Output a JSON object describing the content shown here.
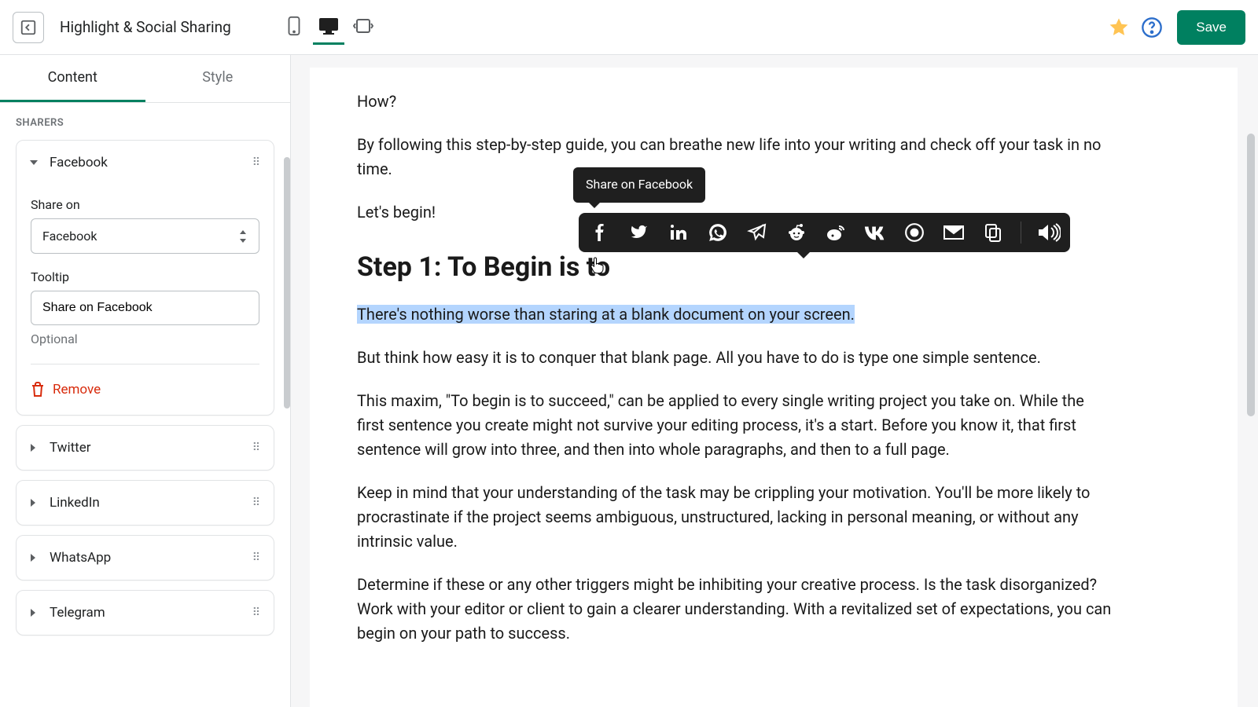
{
  "topbar": {
    "title": "Highlight & Social Sharing",
    "save": "Save"
  },
  "tabs": {
    "content": "Content",
    "style": "Style"
  },
  "sidebar": {
    "section": "SHARERS",
    "items": [
      {
        "name": "Facebook",
        "expanded": true
      },
      {
        "name": "Twitter",
        "expanded": false
      },
      {
        "name": "LinkedIn",
        "expanded": false
      },
      {
        "name": "WhatsApp",
        "expanded": false
      },
      {
        "name": "Telegram",
        "expanded": false
      }
    ],
    "fb": {
      "share_label": "Share on",
      "share_value": "Facebook",
      "tooltip_label": "Tooltip",
      "tooltip_value": "Share on Facebook",
      "optional": "Optional",
      "remove": "Remove"
    }
  },
  "content": {
    "p1": "How?",
    "p2": "By following this step-by-step guide, you can breathe new life into your writing and check off your task in no time.",
    "p3": "Let's begin!",
    "h1": "Step 1: To Begin is to",
    "hl": "There's nothing worse than staring at a blank document on your screen.",
    "p4": "But think how easy it is to conquer that blank page. All you have to do is type one simple sentence.",
    "p5": "This maxim, \"To begin is to succeed,\" can be applied to every single writing project you take on. While the first sentence you create might not survive your editing process, it's a start. Before you know it, that first sentence will grow into three, and then into whole paragraphs, and then to a full page.",
    "p6": "Keep in mind that your understanding of the task may be crippling your motivation. You'll be more likely to procrastinate if the project seems ambiguous, unstructured, lacking in personal meaning, or without any intrinsic value.",
    "p7": "Determine if these or any other triggers might be inhibiting your creative process. Is the task disorganized? Work with your editor or client to gain a clearer understanding. With a revitalized set of expectations, you can begin on your path to success."
  },
  "tooltip_text": "Share on Facebook",
  "share_icons": [
    "facebook",
    "twitter",
    "linkedin",
    "whatsapp",
    "telegram",
    "reddit",
    "weibo",
    "vk",
    "signal",
    "email",
    "copy",
    "speak"
  ]
}
